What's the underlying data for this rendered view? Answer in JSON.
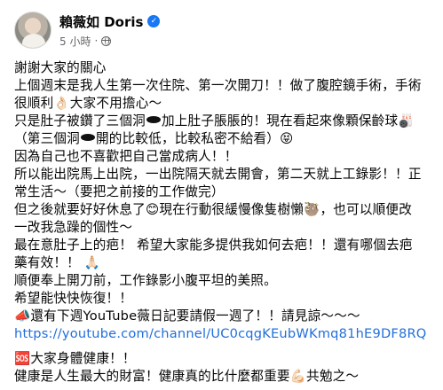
{
  "post": {
    "author": "賴薇如 Doris",
    "timestamp": "5 小時",
    "dot": "·",
    "verified_glyph": "✓",
    "lines": [
      {
        "text": "謝謝大家的關心"
      },
      {
        "text": "上個週末是我人生第一次住院、第一次開刀！！做了腹腔鏡手術，手術"
      },
      {
        "text": "很順利👌🏻大家不用擔心～"
      },
      {
        "pre": "只是肚子被鑽了三個洞",
        "post": "加上肚子脹脹的！現在看起來像顆保齡球🎳"
      },
      {
        "pre": "（第三個洞",
        "post": "開的比較低，比較私密不給看）😝"
      },
      {
        "text": "因為自己也不喜歡把自己當成病人！！"
      },
      {
        "text": "所以能出院馬上出院，一出院隔天就去開會，第二天就上工錄影！！正"
      },
      {
        "text": "常生活～（要把之前接的工作做完）"
      },
      {
        "text": "但之後就要好好休息了😊現在行動很緩慢像隻樹懶🦥，也可以順便改"
      },
      {
        "text": "一改我急躁的個性～"
      },
      {
        "text": "最在意肚子上的疤！ 希望大家能多提供我如何去疤！！還有哪個去疤"
      },
      {
        "text": "藥有效！！ 🙏🏻"
      },
      {
        "text": "順便奉上開刀前，工作錄影小腹平坦的美照。"
      },
      {
        "text": "希望能快快恢復！！"
      },
      {
        "text": "📣還有下週YouTube薇日記要請假一週了！！請見諒～～～"
      },
      {
        "link": "https://youtube.com/channel/UC0cqgKEubWKmq81hE9DF8RQ"
      }
    ],
    "closing": [
      {
        "text": "🆘大家身體健康！！"
      },
      {
        "text": "健康是人生最大的財富！健康真的比什麼都重要💪🏻共勉之～"
      }
    ]
  }
}
